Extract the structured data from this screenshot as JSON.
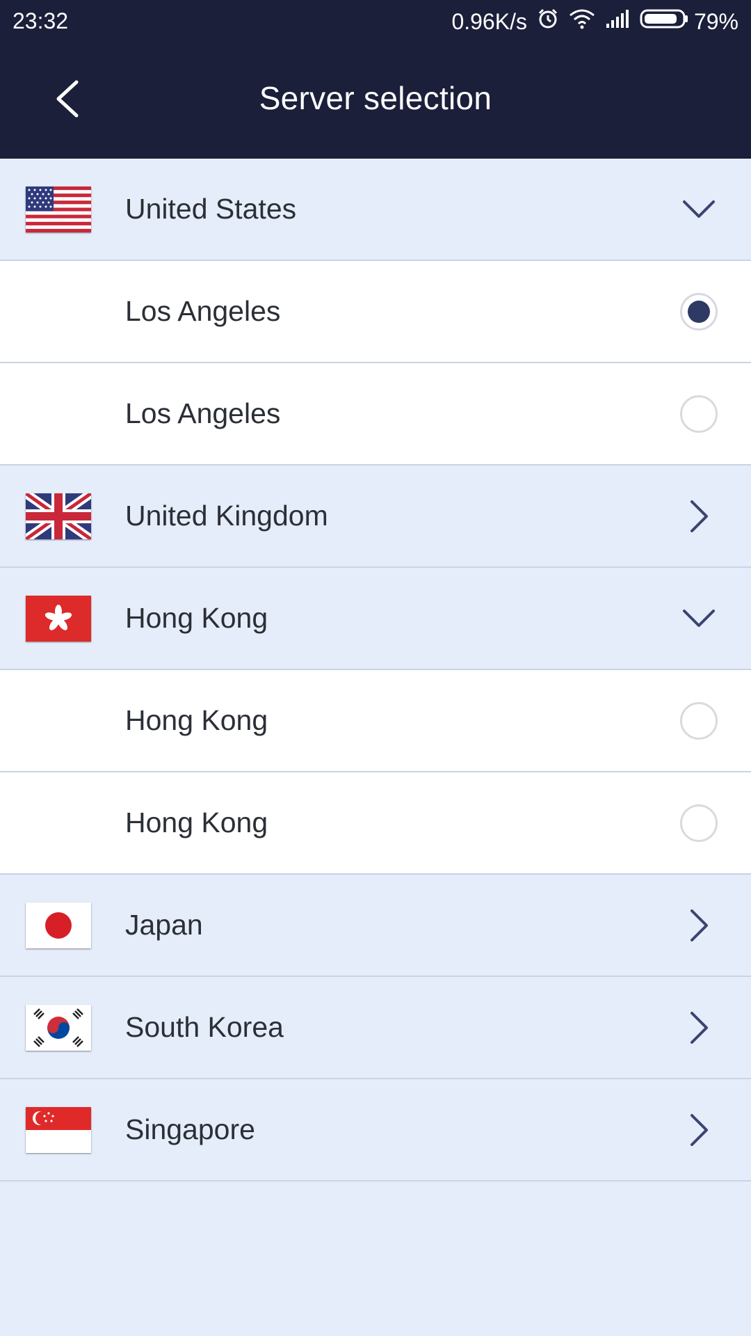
{
  "status_bar": {
    "time": "23:32",
    "net_speed": "0.96K/s",
    "battery_pct": "79%",
    "icons": [
      "alarm-icon",
      "wifi-icon",
      "signal-icon",
      "battery-icon"
    ]
  },
  "header": {
    "title": "Server selection",
    "back_icon": "chevron-left-icon"
  },
  "colors": {
    "header_bg": "#1b1f3a",
    "list_bg": "#e6edfa",
    "city_bg": "#ffffff",
    "radio_selected": "#2e3a64",
    "chevron": "#3a4470"
  },
  "servers": {
    "united_states": {
      "name": "United States",
      "expanded": true
    },
    "us_city_1": {
      "name": "Los Angeles",
      "selected": true
    },
    "us_city_2": {
      "name": "Los Angeles",
      "selected": false
    },
    "united_kingdom": {
      "name": "United Kingdom",
      "expanded": false
    },
    "hong_kong": {
      "name": "Hong Kong",
      "expanded": true
    },
    "hk_city_1": {
      "name": "Hong Kong",
      "selected": false
    },
    "hk_city_2": {
      "name": "Hong Kong",
      "selected": false
    },
    "japan": {
      "name": "Japan",
      "expanded": false
    },
    "south_korea": {
      "name": "South Korea",
      "expanded": false
    },
    "singapore": {
      "name": "Singapore",
      "expanded": false
    }
  }
}
